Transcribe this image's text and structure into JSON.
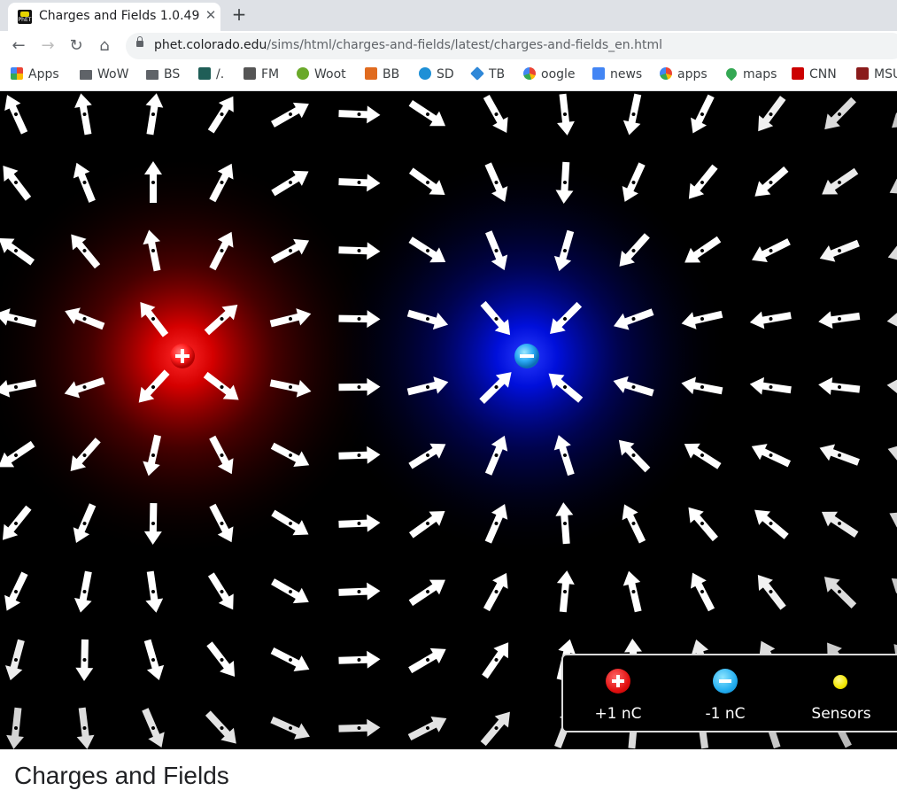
{
  "browser": {
    "tab": {
      "title": "Charges and Fields 1.0.49",
      "favicon": "PhET",
      "close": "✕"
    },
    "new_tab": "+",
    "nav": {
      "back": "←",
      "forward": "→",
      "reload": "↻",
      "home": "⌂"
    },
    "url": {
      "host": "phet.colorado.edu",
      "path": "/sims/html/charges-and-fields/latest/charges-and-fields_en.html"
    },
    "bookmarks": [
      {
        "label": "Apps",
        "icon": "apps-grid-icon"
      },
      {
        "label": "WoW",
        "icon": "folder-icon"
      },
      {
        "label": "BS",
        "icon": "folder-icon"
      },
      {
        "label": "/.",
        "icon": "slashdot-icon"
      },
      {
        "label": "FM",
        "icon": "bookmark-icon"
      },
      {
        "label": "Woot",
        "icon": "woot-icon"
      },
      {
        "label": "BB",
        "icon": "bb-icon"
      },
      {
        "label": "SD",
        "icon": "sd-icon"
      },
      {
        "label": "TB",
        "icon": "tb-icon"
      },
      {
        "label": "oogle",
        "icon": "google-icon"
      },
      {
        "label": "news",
        "icon": "news-icon"
      },
      {
        "label": "apps",
        "icon": "google-icon"
      },
      {
        "label": "maps",
        "icon": "maps-pin-icon"
      },
      {
        "label": "CNN",
        "icon": "cnn-icon"
      },
      {
        "label": "MSU",
        "icon": "msu-icon"
      }
    ]
  },
  "sim": {
    "charges": [
      {
        "sign": "+",
        "color": "#ff1e1e",
        "glow": "#d00000"
      },
      {
        "sign": "−",
        "color": "#2aa9f5",
        "glow": "#0010ff"
      }
    ],
    "toolbox": {
      "items": [
        {
          "label": "+1 nC",
          "icon": "positive-charge-icon"
        },
        {
          "label": "-1 nC",
          "icon": "negative-charge-icon"
        },
        {
          "label": "Sensors",
          "icon": "sensor-icon"
        }
      ]
    }
  },
  "page": {
    "title": "Charges and Fields"
  }
}
